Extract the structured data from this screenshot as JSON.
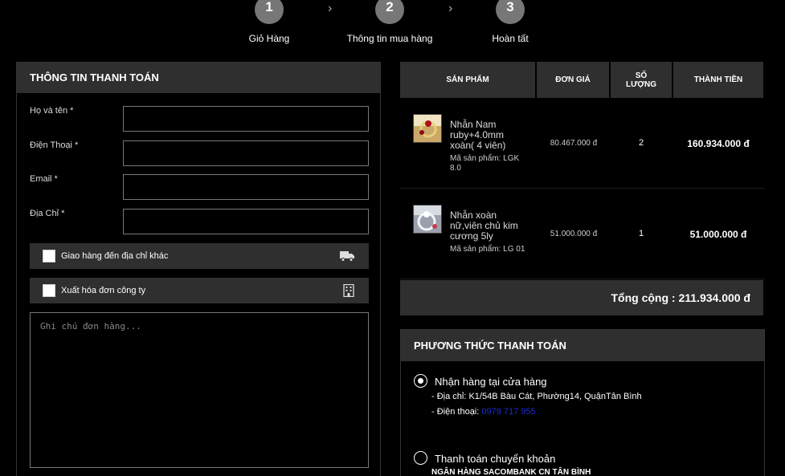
{
  "steps": [
    {
      "number": "1",
      "label": "Giỏ Hàng"
    },
    {
      "number": "2",
      "label": "Thông tin mua hàng"
    },
    {
      "number": "3",
      "label": "Hoàn tất"
    }
  ],
  "billing": {
    "title": "THÔNG TIN THANH TOÁN",
    "fields": [
      {
        "label": "Họ và tên *",
        "value": ""
      },
      {
        "label": "Điện Thoại *",
        "value": ""
      },
      {
        "label": "Email *",
        "value": ""
      },
      {
        "label": "Địa Chỉ *",
        "value": ""
      }
    ],
    "options": [
      {
        "label": "Giao hàng đến địa chỉ khác",
        "icon": "truck-icon"
      },
      {
        "label": "Xuất hóa đơn công ty",
        "icon": "building-icon"
      }
    ],
    "note_placeholder": "Ghi chú đơn hàng..."
  },
  "cart": {
    "headers": [
      "SẢN PHẨM",
      "ĐƠN GIÁ",
      "SỐ LƯỢNG",
      "THÀNH TIỀN"
    ],
    "items": [
      {
        "name": "Nhẫn Nam ruby+4.0mm xoàn( 4 viên)",
        "sku": "Mã sản phẩm: LGK 8.0",
        "price": "80.467.000 đ",
        "qty": "2",
        "total": "160.934.000 đ"
      },
      {
        "name": "Nhẫn xoàn nữ,viên chủ kim cương 5ly",
        "sku": "Mã sản phẩm: LG 01",
        "price": "51.000.000 đ",
        "qty": "1",
        "total": "51.000.000 đ"
      }
    ],
    "grand_total": "Tổng cộng : 211.934.000 đ"
  },
  "payment": {
    "title": "PHƯƠNG THỨC THANH TOÁN",
    "methods": [
      {
        "label": "Nhận hàng tại cửa hàng",
        "selected": true
      },
      {
        "label": "Thanh toán chuyển khoản",
        "selected": false
      }
    ],
    "address": "- Địa chỉ: K1/54B Bàu Cát, Phường14, QuậnTân Bình",
    "phone_prefix": "- Điện thoại: ",
    "phone": "0979 717 955",
    "bank": "NGÂN HÀNG SACOMBANK CN TÂN BÌNH"
  },
  "colors": {
    "link": "#1a2bd8",
    "panel": "#2f2f2f"
  }
}
